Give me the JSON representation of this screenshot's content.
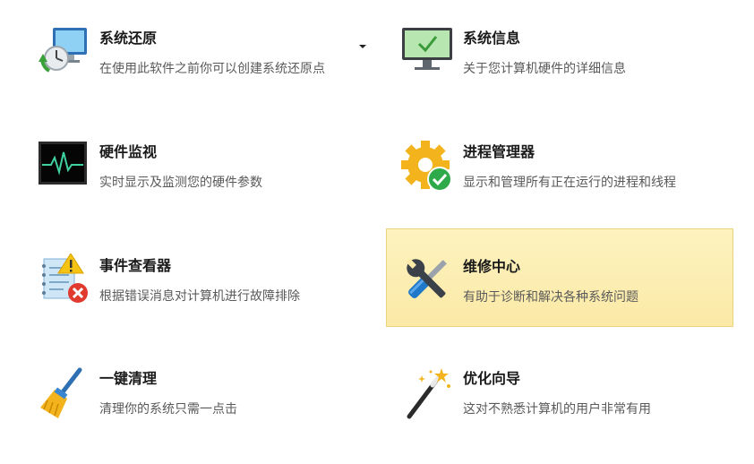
{
  "tools": [
    {
      "title": "系统还原",
      "desc": "在使用此软件之前你可以创建系统还原点",
      "icon": "system-restore-icon"
    },
    {
      "title": "系统信息",
      "desc": "关于您计算机硬件的详细信息",
      "icon": "monitor-check-icon"
    },
    {
      "title": "硬件监视",
      "desc": "实时显示及监测您的硬件参数",
      "icon": "heartbeat-monitor-icon"
    },
    {
      "title": "进程管理器",
      "desc": "显示和管理所有正在运行的进程和线程",
      "icon": "gear-check-icon"
    },
    {
      "title": "事件查看器",
      "desc": "根据错误消息对计算机进行故障排除",
      "icon": "event-log-error-icon"
    },
    {
      "title": "维修中心",
      "desc": "有助于诊断和解决各种系统问题",
      "icon": "wrench-screwdriver-icon"
    },
    {
      "title": "一键清理",
      "desc": "清理你的系统只需一点击",
      "icon": "broom-icon"
    },
    {
      "title": "优化向导",
      "desc": "这对不熟悉计算机的用户非常有用",
      "icon": "magic-wand-icon"
    }
  ],
  "selected_tool": "维修中心",
  "colors": {
    "selected_bg_top": "#fdf3bf",
    "selected_bg_bottom": "#fbe9a6",
    "selected_border": "#ecd27a",
    "title_text": "#1a1a1a",
    "desc_text": "#5a5a5a"
  }
}
